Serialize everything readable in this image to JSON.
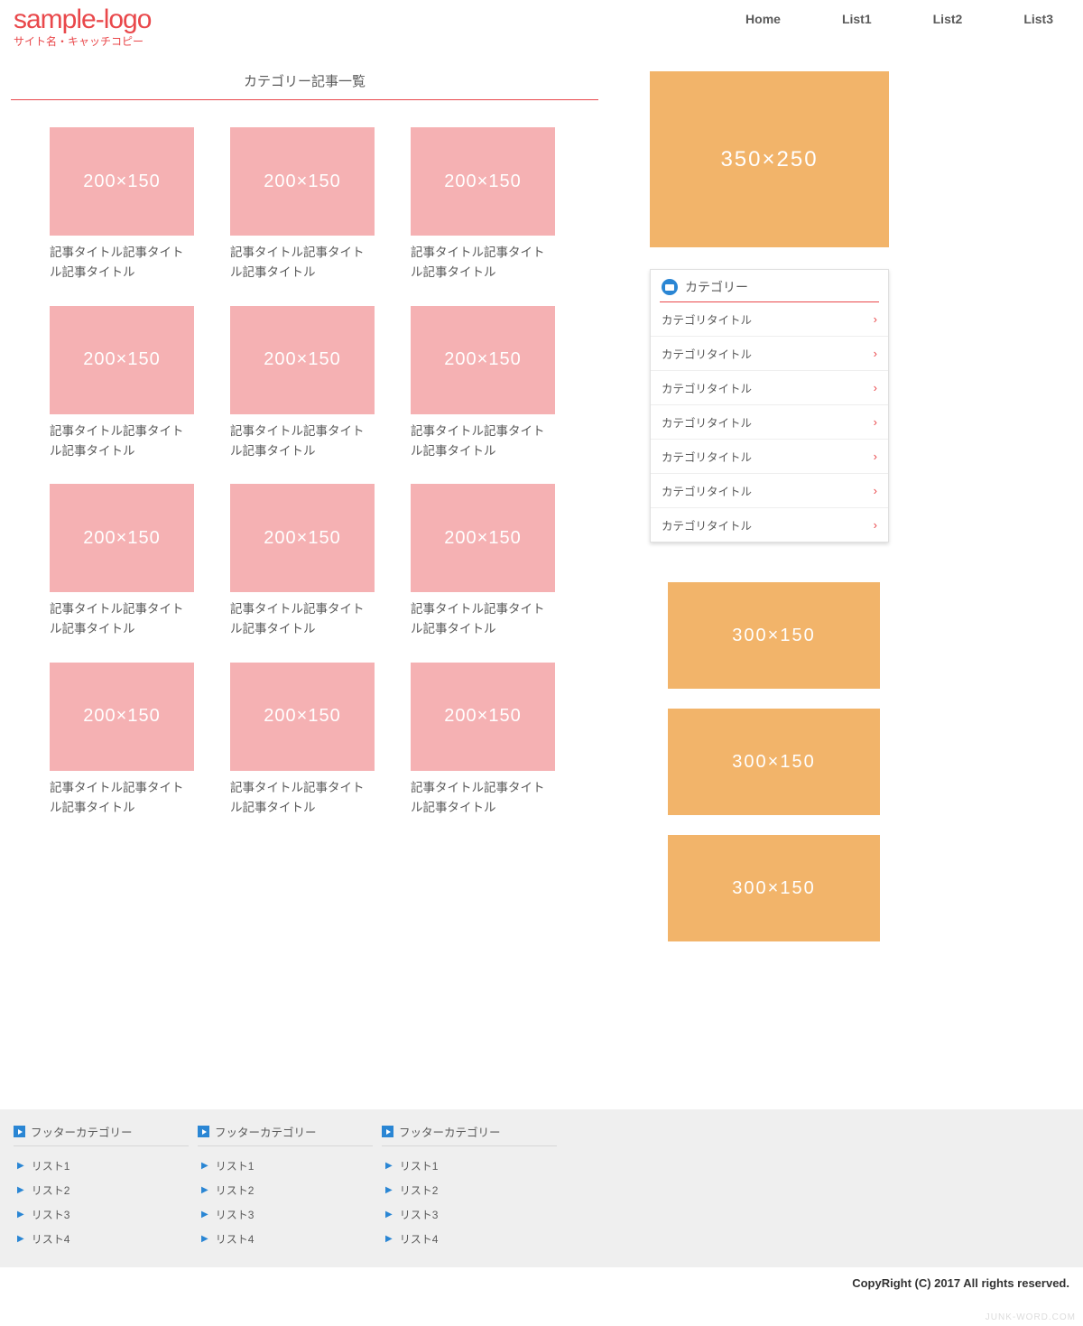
{
  "header": {
    "logo": "sample-logo",
    "tagline": "サイト名・キャッチコピー",
    "nav": [
      "Home",
      "List1",
      "List2",
      "List3"
    ]
  },
  "main": {
    "category_heading": "カテゴリー記事一覧",
    "thumb_label": "200×150",
    "post_title": "記事タイトル記事タイトル記事タイトル",
    "post_count": 12
  },
  "sidebar": {
    "ad_big": "350×250",
    "widget_title": "カテゴリー",
    "category_label": "カテゴリタイトル",
    "category_count": 7,
    "ad_small": "300×150",
    "ad_small_count": 3
  },
  "footer": {
    "col_title": "フッターカテゴリー",
    "col_count": 3,
    "items": [
      "リスト1",
      "リスト2",
      "リスト3",
      "リスト4"
    ],
    "copyright": "CopyRight (C) 2017 All rights reserved.",
    "watermark": "JUNK-WORD.COM"
  }
}
